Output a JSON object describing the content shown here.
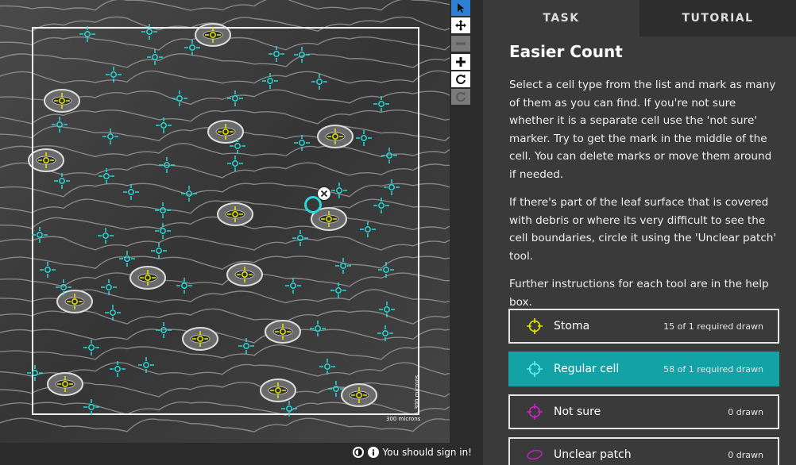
{
  "tabs": {
    "task": "TASK",
    "tutorial": "TUTORIAL"
  },
  "task": {
    "title": "Easier Count",
    "paragraphs": [
      "Select a cell type from the list and mark as many of them as you can find. If you're not sure whether it is a separate cell use the 'not sure' marker. Try to get the mark in the middle of the cell. You can delete marks or move them around if needed.",
      "If there's part of the leaf surface that is covered with debris or where its very difficult to see the cell boundaries, circle it using the 'Unclear patch' tool.",
      "Further instructions for each tool are in the help box."
    ],
    "answers": [
      {
        "label": "Stoma",
        "count": "15 of 1 required drawn",
        "color": "#e8e800",
        "icon": "crosshair-icon"
      },
      {
        "label": "Regular cell",
        "count": "58 of 1 required drawn",
        "color": "#27d9d9",
        "icon": "crosshair-icon"
      },
      {
        "label": "Not sure",
        "count": "0 drawn",
        "color": "#d21fd2",
        "icon": "crosshair-icon"
      },
      {
        "label": "Unclear patch",
        "count": "0 drawn",
        "color": "#c41fc4",
        "icon": "ellipse-icon"
      }
    ]
  },
  "image": {
    "scale_horizontal": "300 microns",
    "scale_vertical": "300 microns"
  },
  "footer": {
    "signin_text": "You should sign in!"
  },
  "tools": [
    "pointer-icon",
    "move-icon",
    "zoom-out-icon",
    "zoom-in-icon",
    "rotate-icon",
    "reset-icon"
  ],
  "colors": {
    "stoma": "#e8e800",
    "regular": "#27d9d9",
    "accent": "#13a2a6",
    "pointer_active": "#2f7fd4"
  }
}
